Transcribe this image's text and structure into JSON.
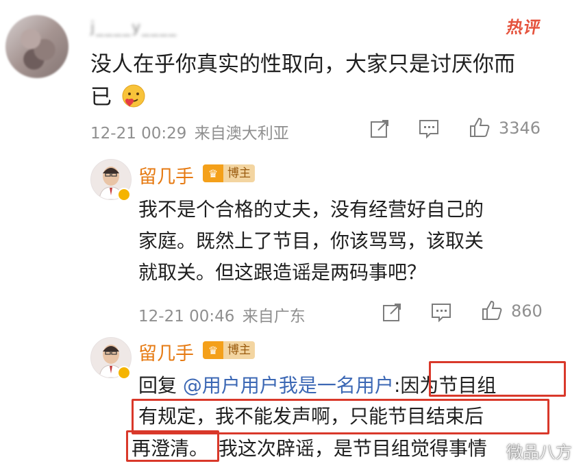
{
  "top_comment": {
    "username": "j____y____",
    "hot_badge": "热评",
    "text_line1": "没人在乎你真实的性取向，大家只是讨厌你而",
    "text_line2": "已",
    "date": "12-21 00:29",
    "location": "来自澳大利亚",
    "likes": "3346"
  },
  "reply1": {
    "name": "留几手",
    "badge": "博主",
    "lines": [
      "我不是个合格的丈夫，没有经营好自己的",
      "家庭。既然上了节目，你该骂骂，该取关",
      "就取关。但这跟造谣是两码事吧？"
    ],
    "date": "12-21 00:46",
    "location": "来自广东",
    "likes": "860"
  },
  "reply2": {
    "name": "留几手",
    "badge": "博主",
    "prefix": "回复",
    "mention": "@用户用户我是一名用户",
    "colon": ":",
    "line1_rest": "因为节目组",
    "line2": "有规定，我不能发声啊，只能节目结束后",
    "line3_a": "再澄清。",
    "line3_b": "我这次辟谣，是节目组觉得事情"
  },
  "watermark": "微品八方",
  "colors": {
    "accent_orange": "#e67a12",
    "highlight_red": "#d9382a",
    "mention_blue": "#3b67b4",
    "hot_red": "#e5533d"
  },
  "icons": [
    "share-icon",
    "comment-icon",
    "like-icon",
    "crown-icon",
    "verified-icon",
    "heart-emoji-icon"
  ]
}
